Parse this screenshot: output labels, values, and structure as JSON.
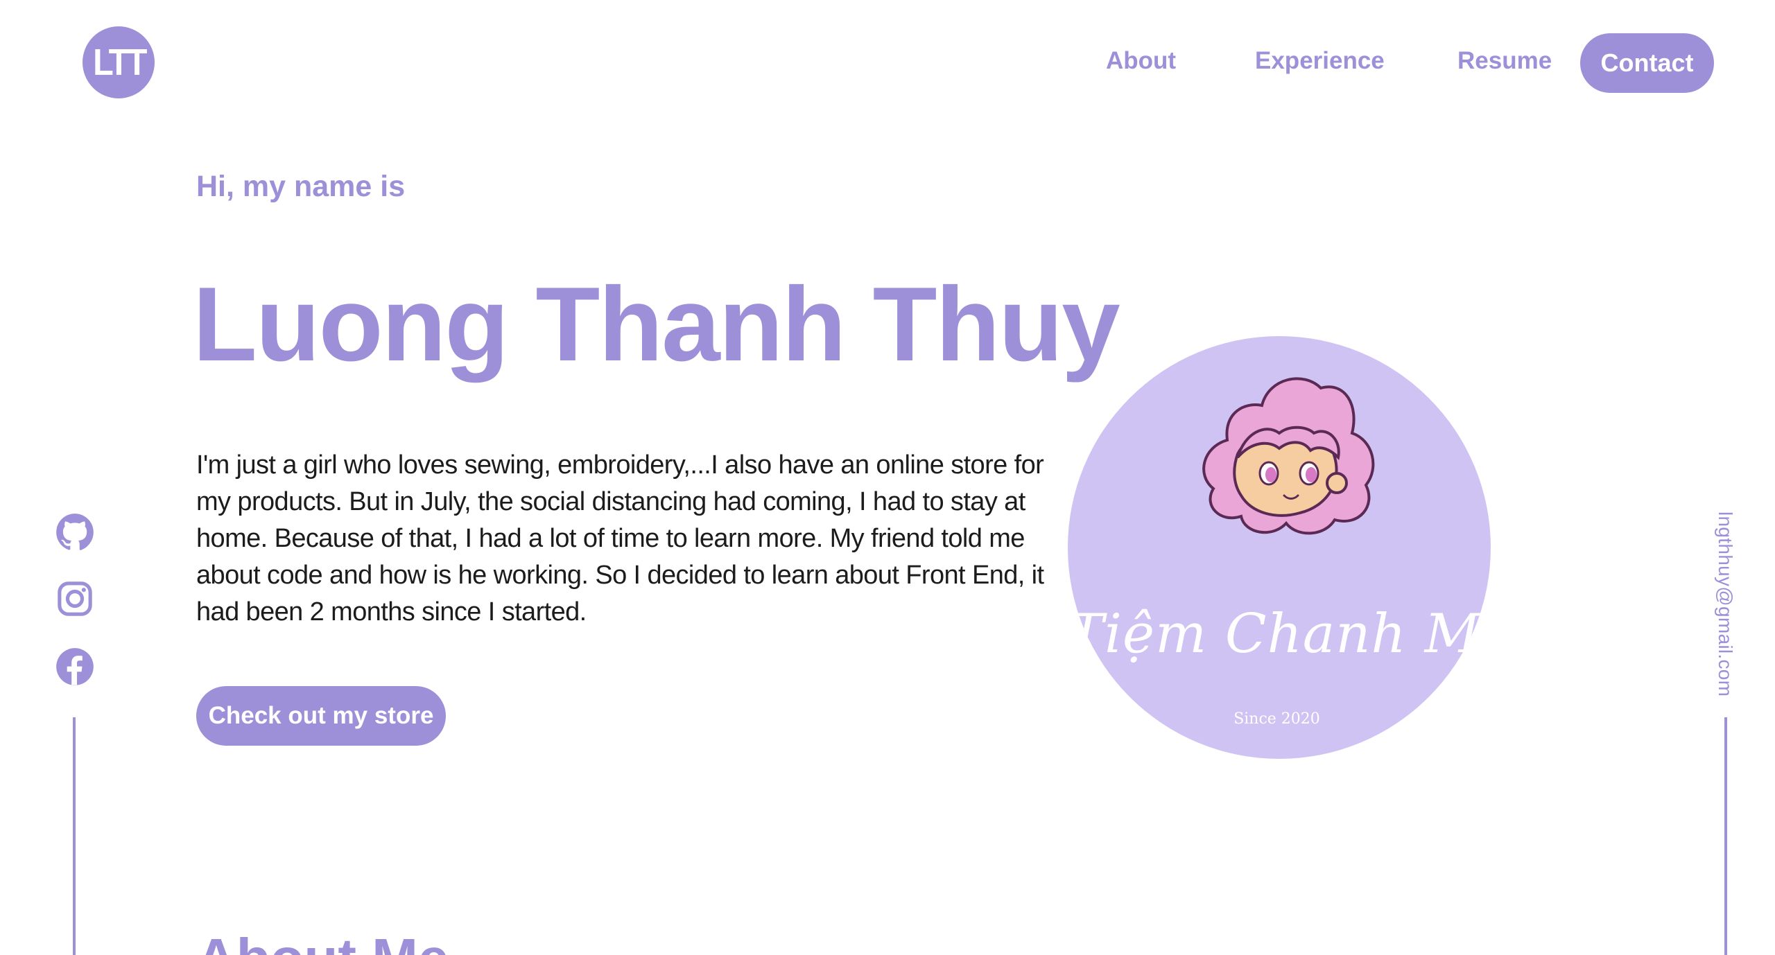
{
  "header": {
    "logo_text": "LTT",
    "nav": {
      "about": "About",
      "experience": "Experience",
      "resume": "Resume",
      "contact": "Contact"
    }
  },
  "hero": {
    "greeting": "Hi, my name is",
    "name": "Luong Thanh Thuy",
    "bio": "I'm just a girl who loves sewing, embroidery,...I also have an online store for my products. But in July, the social distancing had coming, I had to stay at home. Because of that, I had a lot of time to learn more. My friend told me about code and how is he working. So I decided to learn about Front End, it had been 2 months since I started.",
    "store_button": "Check out my store"
  },
  "store_logo": {
    "name": "Tiệm Chanh Mơ",
    "since": "Since 2020"
  },
  "social": {
    "icons": [
      "github-icon",
      "instagram-icon",
      "facebook-icon"
    ]
  },
  "email": "lngthhuy@gmail.com",
  "about_section": {
    "heading": "About Me"
  },
  "colors": {
    "accent": "#9d90d8",
    "logo_bg": "#cfc3f3",
    "hair": "#e9a6d6",
    "skin": "#f6cda0",
    "text": "#1c1c1c",
    "background": "#ffffff"
  }
}
